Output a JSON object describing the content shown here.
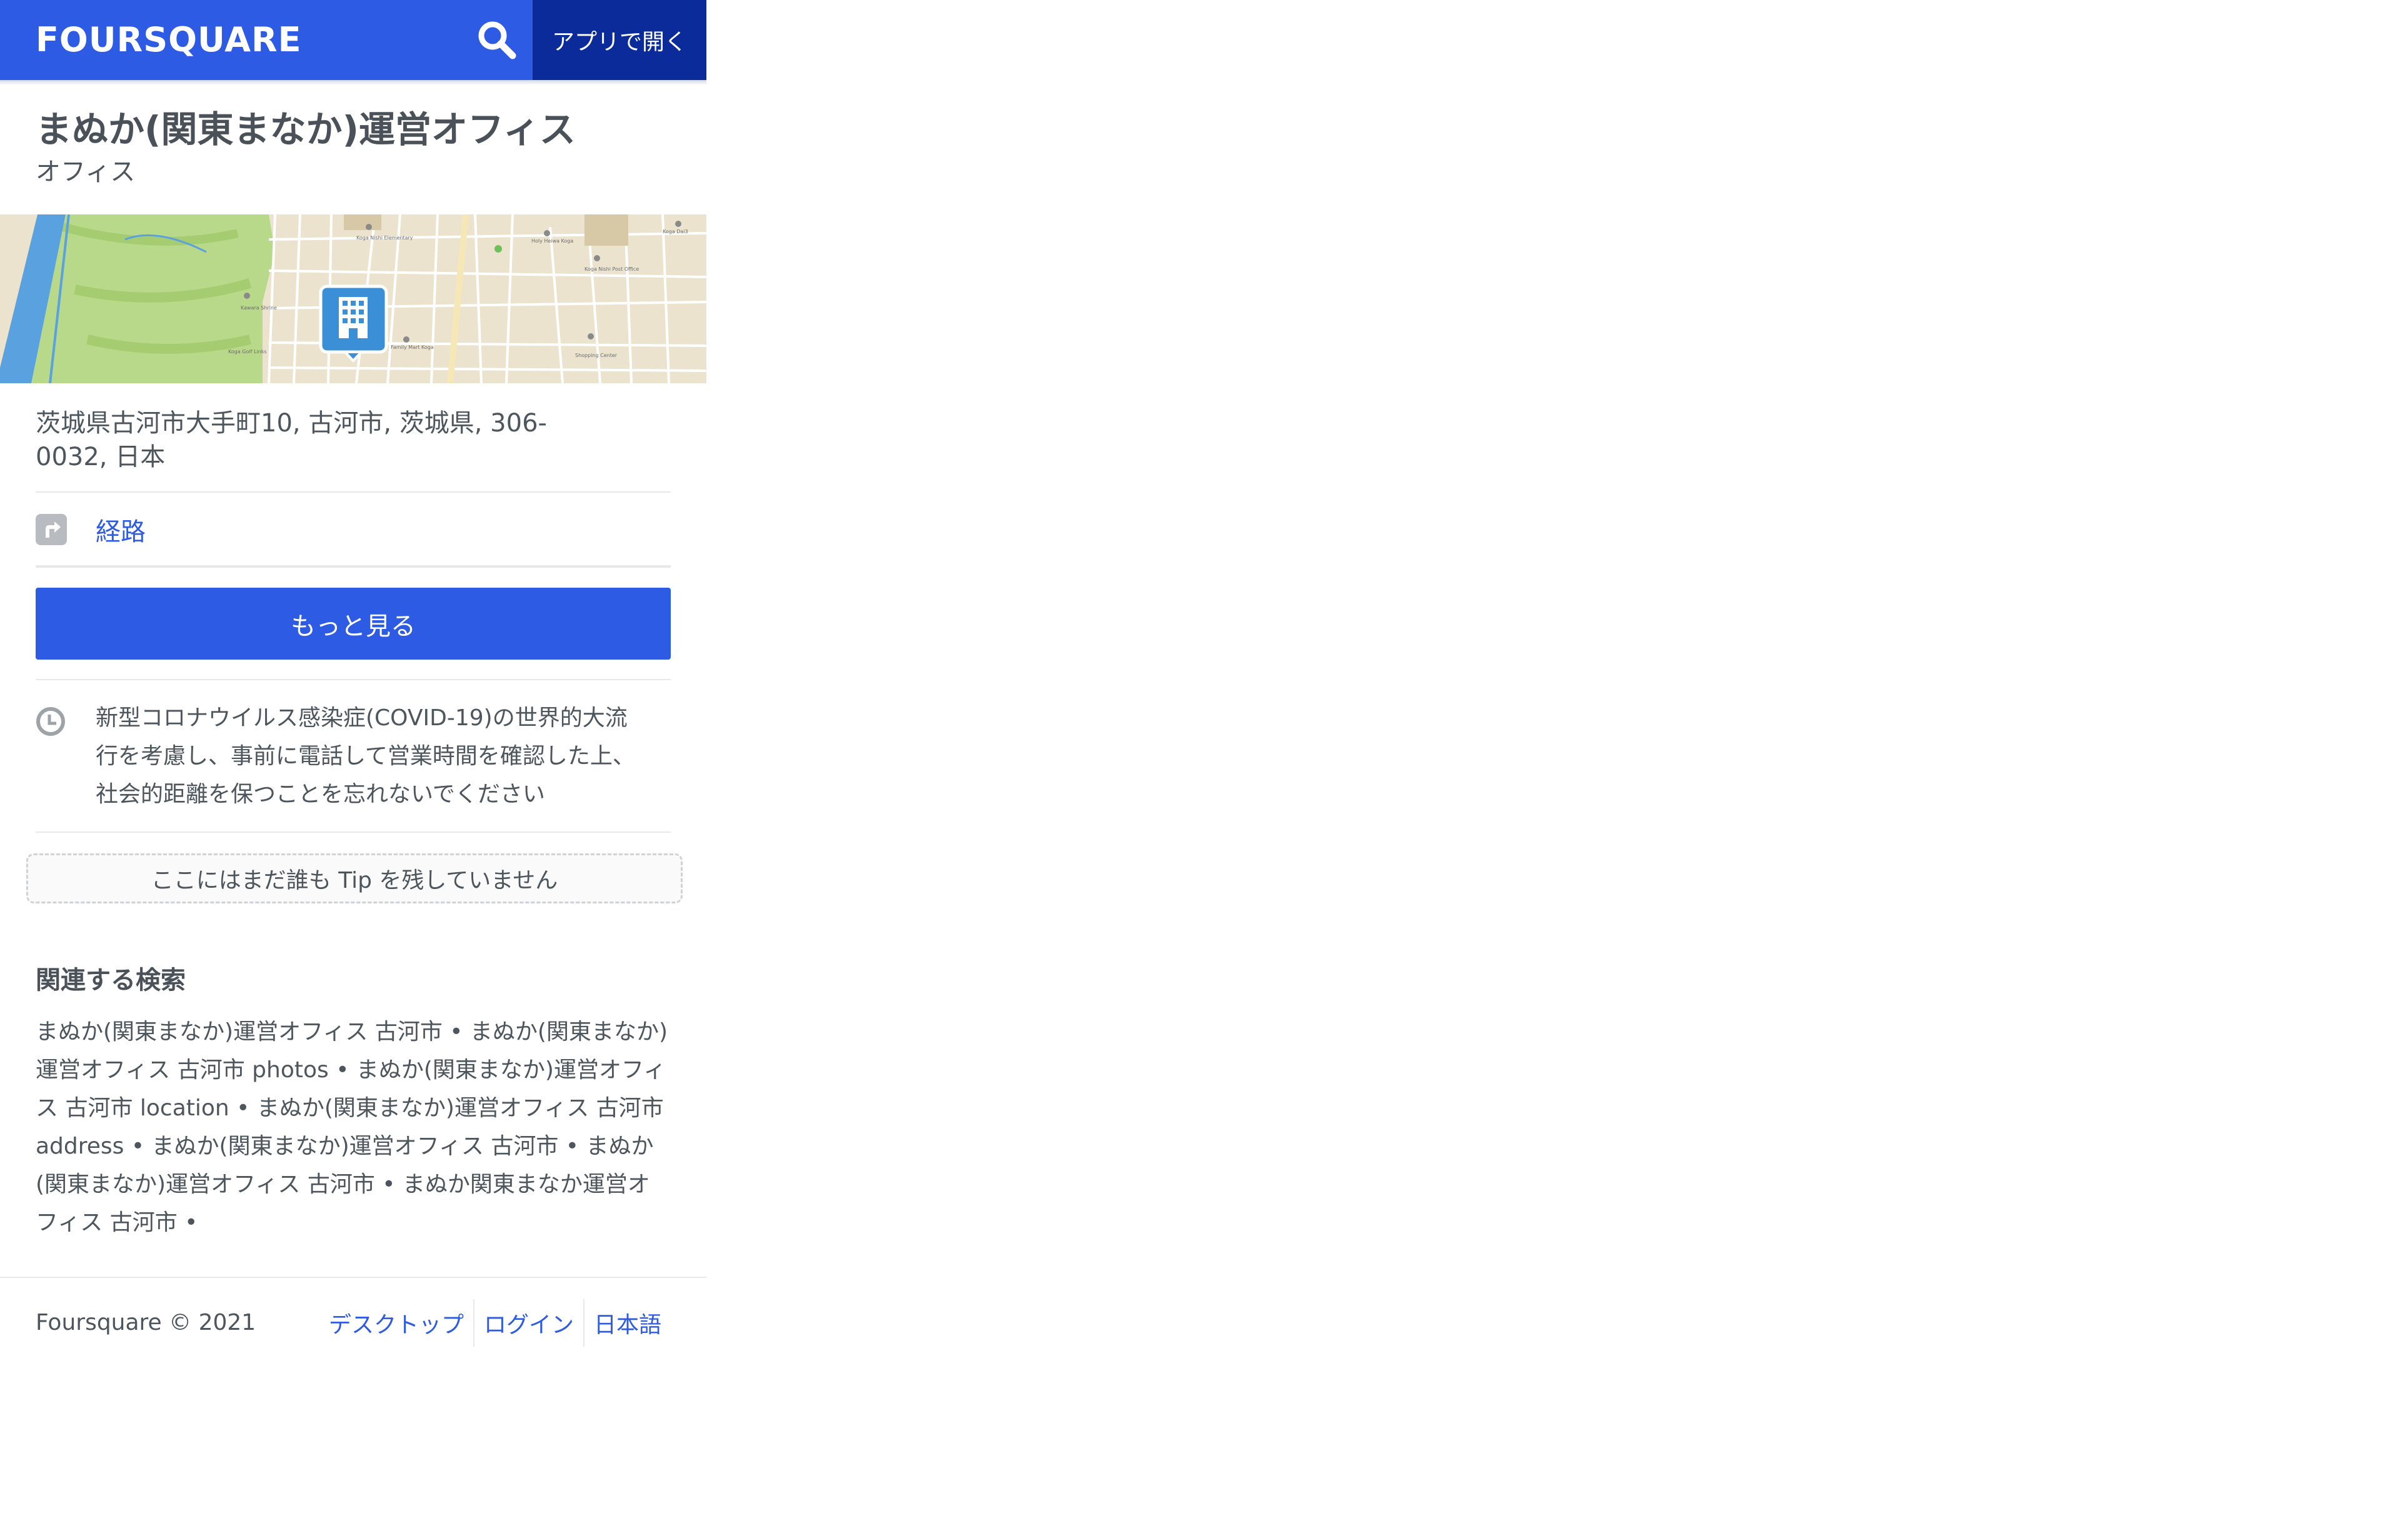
{
  "header": {
    "logo": "FOURSQUARE",
    "open_app_label": "アプリで開く",
    "search_icon": "search-icon"
  },
  "venue": {
    "name": "まぬか(関東まなか)運営オフィス",
    "category": "オフィス",
    "address": "茨城県古河市大手町10, 古河市, 茨城県, 306-0032, 日本"
  },
  "map": {
    "pin_icon": "building-icon",
    "labels": [
      "Koga Nishi Elementary School",
      "Holy Heiwa Koga Hinohara",
      "Koga Nishi Post Office",
      "Koga Daishi",
      "Kawara Shrine",
      "Koga Golf Links",
      "Family Mart Koga Takatamachi",
      "Shopping Center Morimoto 101",
      "Koga Dai3 Elementary School"
    ]
  },
  "actions": {
    "directions_label": "経路",
    "more_label": "もっと見る"
  },
  "covid_notice": "新型コロナウイルス感染症(COVID-19)の世界的大流行を考慮し、事前に電話して営業時間を確認した上、社会的距離を保つことを忘れないでください",
  "tips_empty": "ここにはまだ誰も Tip を残していません",
  "related": {
    "title": "関連する検索",
    "text": "まぬか(関東まなか)運営オフィス 古河市 • まぬか(関東まなか)運営オフィス 古河市 photos • まぬか(関東まなか)運営オフィス 古河市 location • まぬか(関東まなか)運営オフィス 古河市 address • まぬか(関東まなか)運営オフィス 古河市 • まぬか(関東まなか)運営オフィス 古河市 • まぬか関東まなか運営オフィス 古河市 •"
  },
  "footer": {
    "copyright": "Foursquare © 2021",
    "links": [
      "デスクトップ",
      "ログイン",
      "日本語"
    ]
  },
  "colors": {
    "brand_blue": "#2d5be3",
    "header_dark": "#0c2b9b",
    "text_gray": "#4e565d"
  }
}
